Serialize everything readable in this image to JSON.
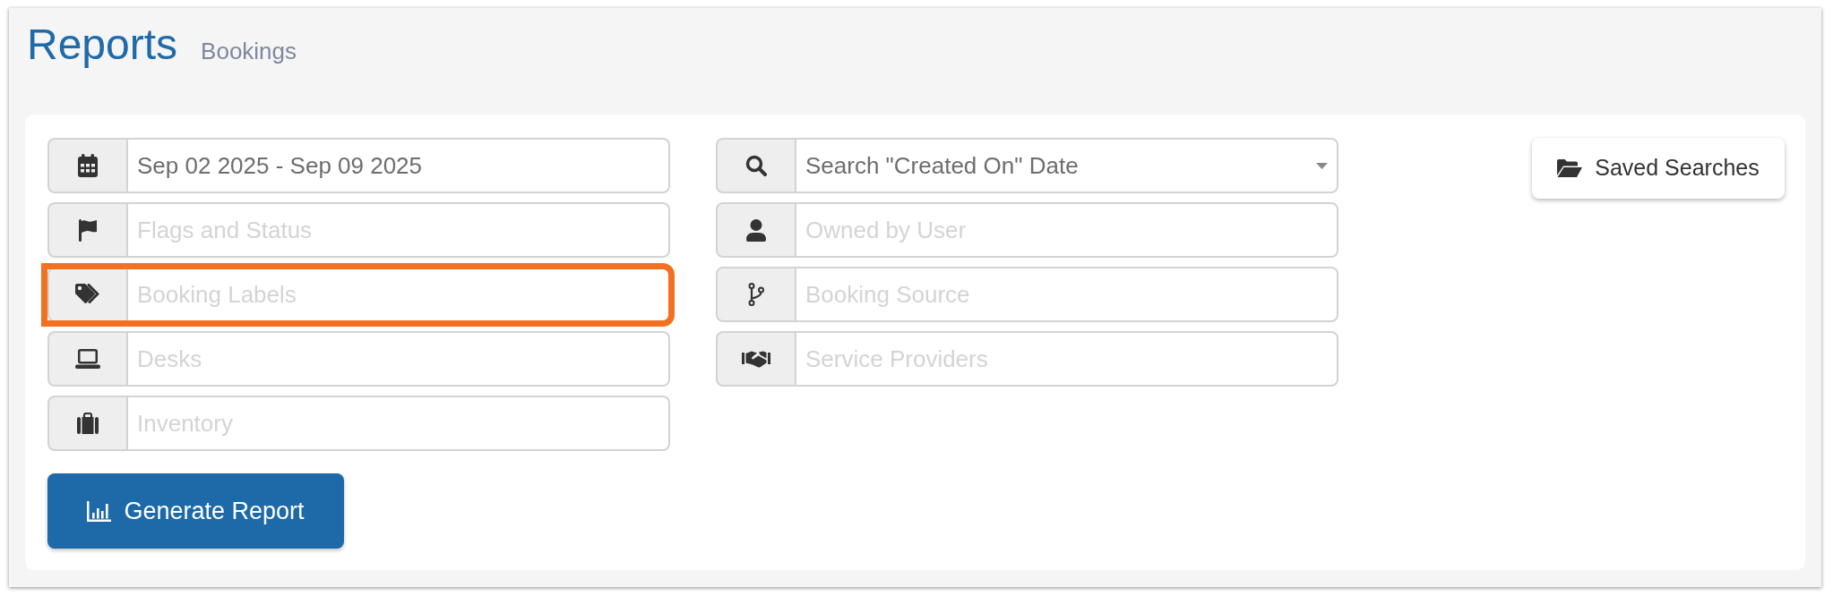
{
  "header": {
    "title": "Reports",
    "subtitle": "Bookings"
  },
  "filters": {
    "left": [
      {
        "kind": "text",
        "value": "Sep 02 2025 - Sep 09 2025",
        "highlighted": false
      },
      {
        "kind": "text",
        "placeholder": "Flags and Status",
        "highlighted": false
      },
      {
        "kind": "text",
        "placeholder": "Booking Labels",
        "highlighted": true
      },
      {
        "kind": "text",
        "placeholder": "Desks",
        "highlighted": false
      },
      {
        "kind": "text",
        "placeholder": "Inventory",
        "highlighted": false
      }
    ],
    "right": [
      {
        "kind": "select",
        "value": "Search \"Created On\" Date",
        "highlighted": false
      },
      {
        "kind": "text",
        "placeholder": "Owned by User",
        "highlighted": false
      },
      {
        "kind": "text",
        "placeholder": "Booking Source",
        "highlighted": false
      },
      {
        "kind": "text",
        "placeholder": "Service Providers",
        "highlighted": false
      }
    ]
  },
  "saved_searches_button": {
    "label": "Saved Searches"
  },
  "generate_button": {
    "label": "Generate Report"
  }
}
